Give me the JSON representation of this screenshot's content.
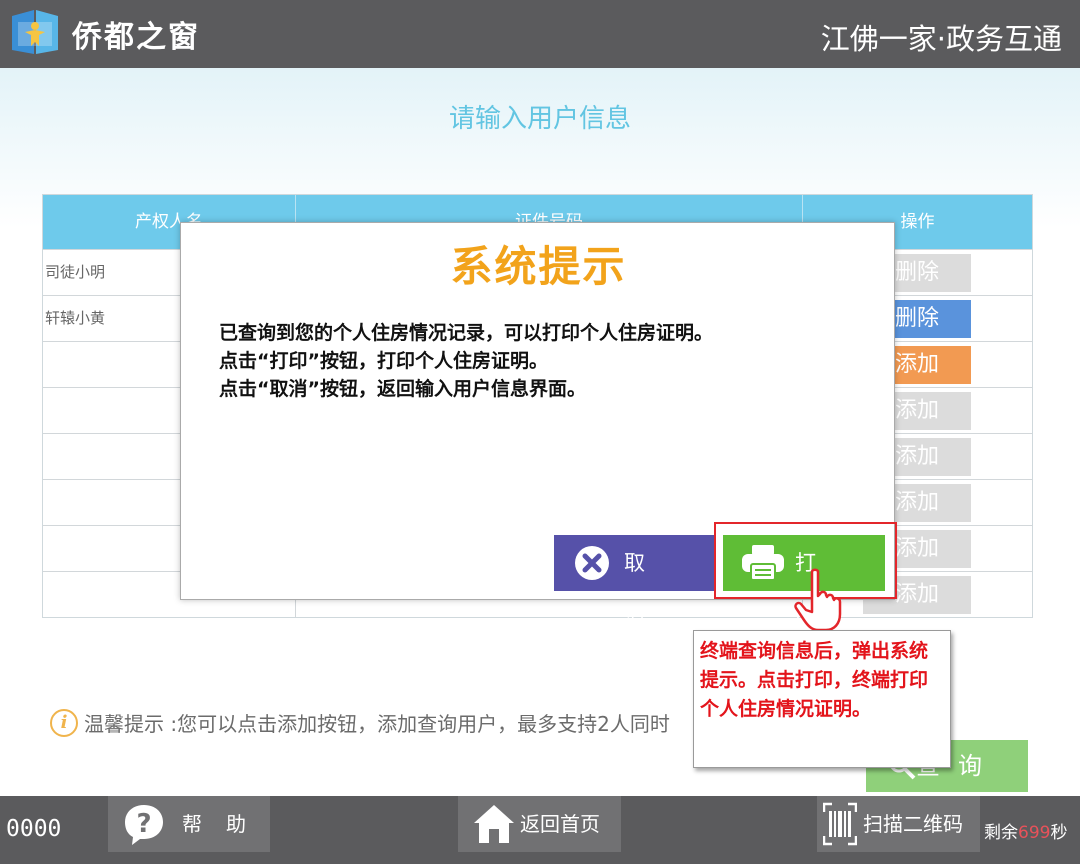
{
  "header": {
    "app_title": "侨都之窗",
    "slogan": "江佛一家·政务互通"
  },
  "page": {
    "heading": "请输入用户信息"
  },
  "table": {
    "columns": [
      "产权人名",
      "证件号码",
      "操作"
    ],
    "rows": [
      {
        "name": "司徒小明",
        "action": "删除",
        "action_state": "disabled"
      },
      {
        "name": "轩辕小黄",
        "action": "删除",
        "action_state": "active"
      },
      {
        "name": "",
        "action": "添加",
        "action_state": "active"
      },
      {
        "name": "",
        "action": "添加",
        "action_state": "disabled"
      },
      {
        "name": "",
        "action": "添加",
        "action_state": "disabled"
      },
      {
        "name": "",
        "action": "添加",
        "action_state": "disabled"
      },
      {
        "name": "",
        "action": "添加",
        "action_state": "disabled"
      },
      {
        "name": "",
        "action": "添加",
        "action_state": "disabled"
      }
    ]
  },
  "tip": {
    "icon": "info-icon",
    "text": "温馨提示 :您可以点击添加按钮，添加查询用户，最多支持2人同时"
  },
  "query_button": {
    "label": "查询",
    "icon": "search-icon"
  },
  "modal": {
    "title": "系统提示",
    "lines": [
      "已查询到您的个人住房情况记录，可以打印个人住房证明。",
      "点击“打印”按钮，打印个人住房证明。",
      "点击“取消”按钮，返回输入用户信息界面。"
    ],
    "cancel_label": "取消",
    "print_label": "打印"
  },
  "callout": {
    "text": "终端查询信息后，弹出系统提示。点击打印，终端打印个人住房情况证明。"
  },
  "bottom": {
    "counter": "0000",
    "help_label": "帮助",
    "home_label": "返回首页",
    "scan_label": "扫描二维码",
    "timer_prefix": "剩余",
    "timer_value": "699",
    "timer_suffix": "秒"
  },
  "colors": {
    "header_bg": "#5b5b5d",
    "table_header": "#6ecaeb",
    "modal_title": "#f2a31b",
    "cancel_button": "#5651a9",
    "print_button": "#5fbd36",
    "delete_button": "#5a93dc",
    "add_button": "#f29a52",
    "disabled_button": "#dcdcdc",
    "callout_text": "#e3141b"
  }
}
